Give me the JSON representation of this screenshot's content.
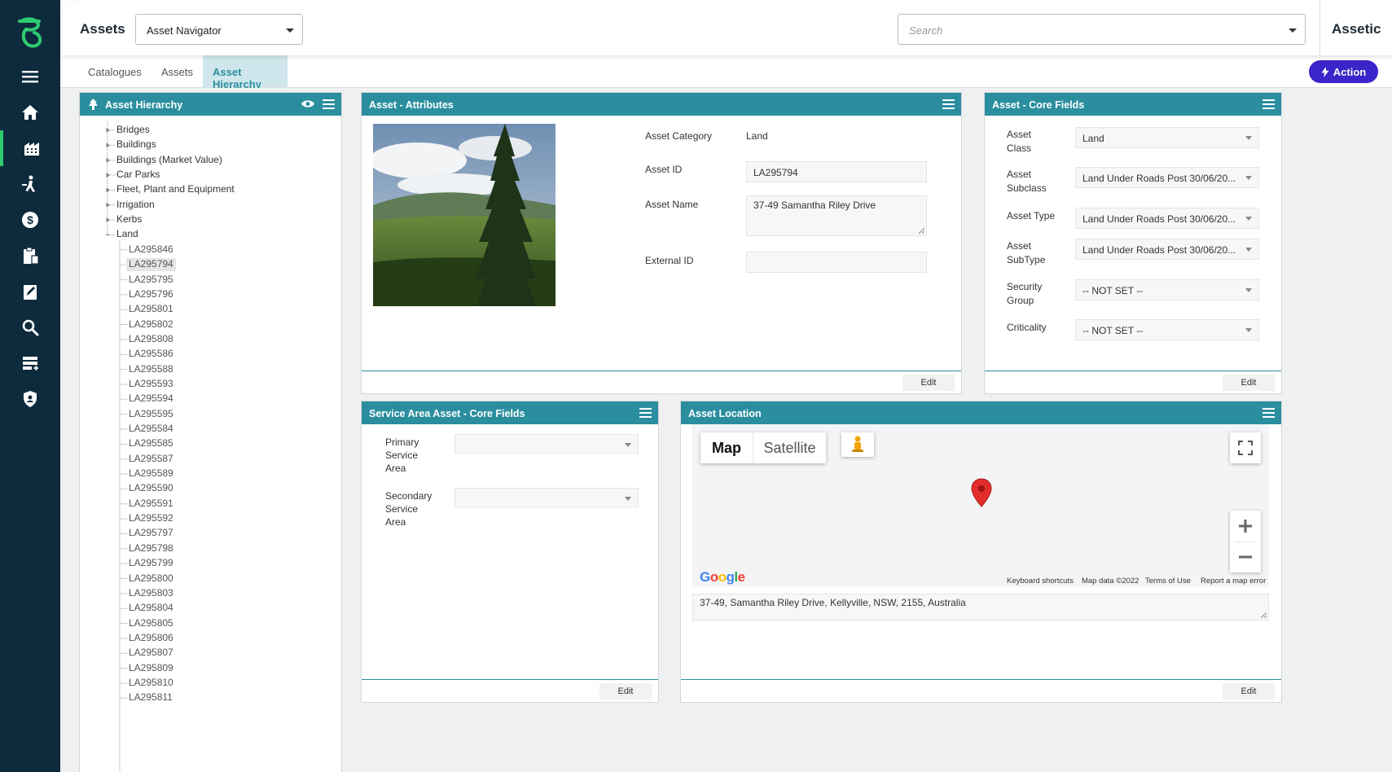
{
  "header": {
    "module_title": "Assets",
    "navigator_value": "Asset Navigator",
    "search_placeholder": "Search",
    "brand": "Assetic"
  },
  "tabs": [
    {
      "label": "Catalogues",
      "active": false
    },
    {
      "label": "Assets",
      "active": false
    },
    {
      "label": "Asset Hierarchy",
      "active": true
    }
  ],
  "action_label": "Action",
  "sidebar_icons": [
    "menu-icon",
    "home-icon",
    "buildings-icon",
    "worker-icon",
    "money-icon",
    "clipboard-icon",
    "edit-icon",
    "search-icon",
    "list-icon",
    "shield-icon"
  ],
  "hierarchy": {
    "title": "Asset Hierarchy",
    "roots": [
      "Bridges",
      "Buildings",
      "Buildings (Market Value)",
      "Car Parks",
      "Fleet, Plant and Equipment",
      "Irrigation",
      "Kerbs",
      "Land"
    ],
    "land_children": [
      "LA295846",
      "LA295794",
      "LA295795",
      "LA295796",
      "LA295801",
      "LA295802",
      "LA295808",
      "LA295586",
      "LA295588",
      "LA295593",
      "LA295594",
      "LA295595",
      "LA295584",
      "LA295585",
      "LA295587",
      "LA295589",
      "LA295590",
      "LA295591",
      "LA295592",
      "LA295797",
      "LA295798",
      "LA295799",
      "LA295800",
      "LA295803",
      "LA295804",
      "LA295805",
      "LA295806",
      "LA295807",
      "LA295809",
      "LA295810",
      "LA295811"
    ],
    "selected": "LA295794"
  },
  "attributes": {
    "title": "Asset - Attributes",
    "category_label": "Asset Category",
    "category_value": "Land",
    "id_label": "Asset ID",
    "id_value": "LA295794",
    "name_label": "Asset Name",
    "name_value": "37-49 Samantha Riley Drive",
    "external_label": "External ID",
    "external_value": "",
    "edit_label": "Edit"
  },
  "core": {
    "title": "Asset - Core Fields",
    "fields": [
      {
        "label1": "Asset",
        "label2": "Class",
        "value": "Land"
      },
      {
        "label1": "Asset",
        "label2": "Subclass",
        "value": "Land Under Roads Post 30/06/20..."
      },
      {
        "label1": "Asset Type",
        "label2": "",
        "value": "Land Under Roads Post 30/06/20..."
      },
      {
        "label1": "Asset",
        "label2": "SubType",
        "value": "Land Under Roads Post 30/06/20..."
      },
      {
        "label1": "Security",
        "label2": "Group",
        "value": "-- NOT SET --"
      },
      {
        "label1": "Criticality",
        "label2": "",
        "value": "-- NOT SET --"
      }
    ],
    "edit_label": "Edit"
  },
  "service": {
    "title": "Service Area Asset - Core Fields",
    "primary": [
      "Primary",
      "Service",
      "Area"
    ],
    "secondary": [
      "Secondary",
      "Service",
      "Area"
    ],
    "edit_label": "Edit"
  },
  "location": {
    "title": "Asset Location",
    "map_tab": "Map",
    "satellite_tab": "Satellite",
    "google": "Google",
    "keyboard": "Keyboard shortcuts",
    "mapdata": "Map data ©2022",
    "terms": "Terms of Use",
    "report": "Report a map error",
    "address": "37-49, Samantha Riley Drive, Kellyville, NSW, 2155, Australia",
    "edit_label": "Edit"
  },
  "colors": {
    "teal": "#2a8e9f",
    "sidebar": "#0e2b3d",
    "action": "#3b24c9",
    "pin": "#e32d2d"
  }
}
